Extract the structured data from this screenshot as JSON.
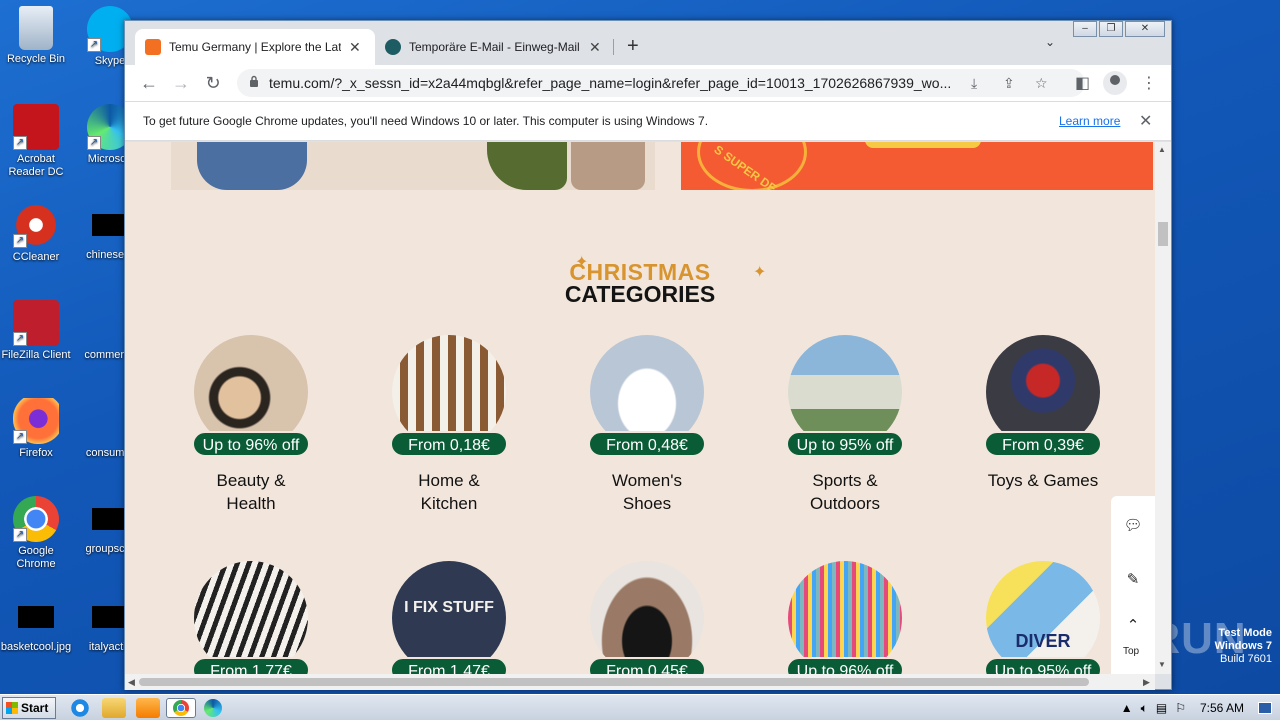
{
  "desktop": {
    "icons_left": [
      {
        "name": "recycle-bin",
        "label": "Recycle Bin"
      },
      {
        "name": "acrobat-reader",
        "label": "Acrobat Reader DC"
      },
      {
        "name": "ccleaner",
        "label": "CCleaner"
      },
      {
        "name": "filezilla",
        "label": "FileZilla Client"
      },
      {
        "name": "firefox",
        "label": "Firefox"
      },
      {
        "name": "google-chrome",
        "label": "Google Chrome"
      },
      {
        "name": "basketcool",
        "label": "basketcool.jpg"
      }
    ],
    "icons_right": [
      {
        "name": "skype",
        "label": "Skype"
      },
      {
        "name": "microsoft-edge",
        "label": "Microsoft"
      },
      {
        "name": "chineseur",
        "label": "chineseur"
      },
      {
        "name": "commerce",
        "label": "commerce"
      },
      {
        "name": "consumer",
        "label": "consumer"
      },
      {
        "name": "groupscor",
        "label": "groupscor"
      },
      {
        "name": "italyactiv",
        "label": "italyactiv"
      }
    ],
    "watermark": {
      "line1": "Test Mode",
      "line2": "Windows 7",
      "line3": "Build 7601"
    },
    "anyrun": "ANY RUN"
  },
  "browser": {
    "tabs": [
      {
        "title": "Temu Germany | Explore the Latest C",
        "active": true,
        "favicon_color": "#f36f21"
      },
      {
        "title": "Temporäre E-Mail - Einweg-Mail - Ano",
        "active": false,
        "favicon_color": "#1d5c63"
      }
    ],
    "url": "temu.com/?_x_sessn_id=x2a44mqbgl&refer_page_name=login&refer_page_id=10013_1702626867939_wo...",
    "infobar": {
      "message": "To get future Google Chrome updates, you'll need Windows 10 or later. This computer is using Windows 7.",
      "link": "Learn more"
    }
  },
  "page": {
    "heading_top": "CHRISTMAS",
    "heading_bottom": "CATEGORIES",
    "banner_text": "S SUPER DE",
    "categories_row1": [
      {
        "badge": "Up to 96% off",
        "label1": "Beauty &",
        "label2": "Health",
        "color": "#c9a98d"
      },
      {
        "badge": "From 0,18€",
        "label1": "Home &",
        "label2": "Kitchen",
        "color": "#8a5a34"
      },
      {
        "badge": "From 0,48€",
        "label1": "Women's",
        "label2": "Shoes",
        "color": "#b9c6d6"
      },
      {
        "badge": "Up to 95% off",
        "label1": "Sports &",
        "label2": "Outdoors",
        "color": "#6f8f5a"
      },
      {
        "badge": "From 0,39€",
        "label1": "Toys & Games",
        "label2": "",
        "color": "#3b3b44"
      }
    ],
    "categories_row2": [
      {
        "badge": "From 1,77€",
        "color": "#a89c8e"
      },
      {
        "badge": "From 1,47€",
        "color": "#2f3a52",
        "shirt_text": "I FIX STUFF"
      },
      {
        "badge": "From 0,45€",
        "color": "#9a7a66"
      },
      {
        "badge": "Up to 96% off",
        "color": "#7fb7bf"
      },
      {
        "badge": "Up to 95% off",
        "color": "#d8d4c8",
        "shirt_text": "DIVER"
      }
    ],
    "side_tools": {
      "top_label": "Top"
    }
  },
  "taskbar": {
    "start_label": "Start",
    "clock": "7:56 AM"
  }
}
